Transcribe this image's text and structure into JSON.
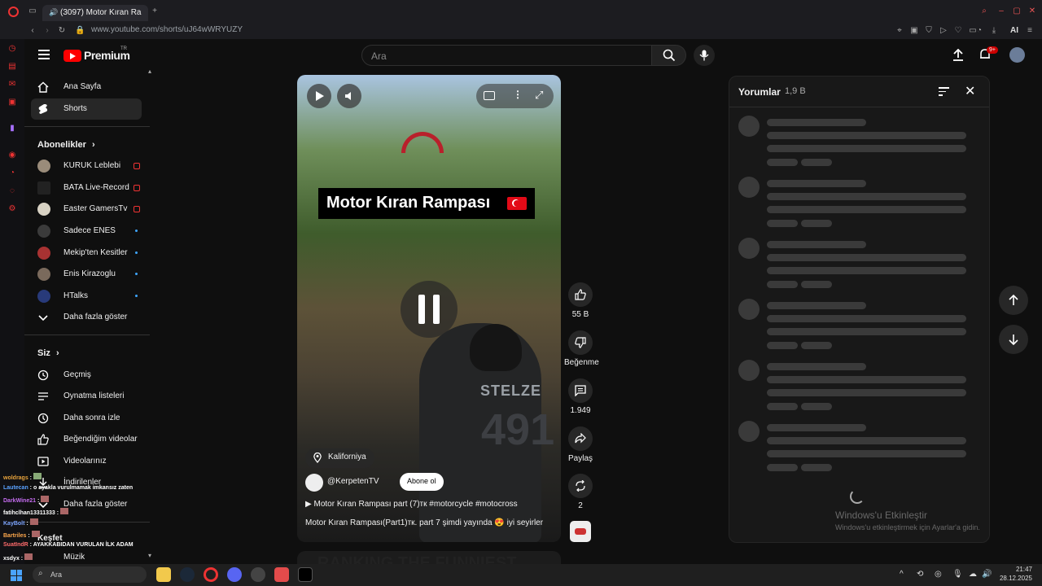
{
  "browser": {
    "tab_title": "(3097) Motor Kıran Ra",
    "url": "www.youtube.com/shorts/uJ64wWRYUZY",
    "ai_label": "AI"
  },
  "header": {
    "logo_text": "Premium",
    "logo_region": "TR",
    "search_placeholder": "Ara",
    "notifications_badge": "9+"
  },
  "guide": {
    "main": [
      {
        "label": "Ana Sayfa",
        "icon": "home-icon"
      },
      {
        "label": "Shorts",
        "icon": "shorts-icon",
        "active": true
      }
    ],
    "subscriptions_title": "Abonelikler",
    "subscriptions": [
      {
        "label": "KURUK Leblebi",
        "status": "live"
      },
      {
        "label": "BATA Live-Record",
        "status": "live"
      },
      {
        "label": "Easter GamersTv",
        "status": "live"
      },
      {
        "label": "Sadece ENES",
        "status": "new"
      },
      {
        "label": "Mekip'ten Kesitler",
        "status": "new"
      },
      {
        "label": "Enis Kirazoglu",
        "status": "new"
      },
      {
        "label": "HTalks",
        "status": "new"
      }
    ],
    "show_more": "Daha fazla göster",
    "you_title": "Siz",
    "you": [
      {
        "label": "Geçmiş",
        "icon": "history-icon"
      },
      {
        "label": "Oynatma listeleri",
        "icon": "playlist-icon"
      },
      {
        "label": "Daha sonra izle",
        "icon": "clock-icon"
      },
      {
        "label": "Beğendiğim videolar",
        "icon": "like-icon"
      },
      {
        "label": "Videolarınız",
        "icon": "video-icon"
      },
      {
        "label": "İndirilenler",
        "icon": "download-icon"
      },
      {
        "label": "Daha fazla göster",
        "icon": "chevron-down-icon"
      }
    ],
    "explore_title": "Keşfet",
    "music_label": "Müzik"
  },
  "video": {
    "title_overlay": "Motor Kıran Rampası",
    "location": "Kaliforniya",
    "channel": "@KerpetenTV",
    "subscribe": "Abone ol",
    "description_1": "Motor Kıran Rampası part (7)тк #motorcycle #motocross",
    "description_2": "Motor Kıran Rampası(Part1)тк.      part 7 şimdi yayında 😍 iyi seyirler",
    "next_title": "RANKING THE FUNNIEST"
  },
  "actions": {
    "likes": "55 B",
    "dislike": "Beğenme",
    "comments": "1.949",
    "share": "Paylaş",
    "remix": "2"
  },
  "comments_panel": {
    "title": "Yorumlar",
    "count": "1,9 B"
  },
  "watermark": {
    "line1": "Windows'u Etkinleştir",
    "line2": "Windows'u etkinleştirmek için Ayarlar'a gidin."
  },
  "chat_overlay": [
    {
      "user": "woldrags",
      "text": "",
      "color": "#e6a23c"
    },
    {
      "user": "Lautecan",
      "text": "o ayakla vurulmamak imkansız zaten",
      "color": "#5aa2ff"
    },
    {
      "user": "DarkWine21",
      "text": "",
      "color": "#c56cf0"
    },
    {
      "user": "fatihclhan13311333",
      "text": "",
      "color": "#ffffff"
    },
    {
      "user": "KayBolt",
      "text": "",
      "color": "#7ea6ff"
    },
    {
      "user": "Bartriles",
      "text": "",
      "color": "#ffa94d"
    },
    {
      "user": "SuatIndR",
      "text": "AYAKKABIDAN VURULAN İLK ADAM",
      "color": "#ff6b6b"
    },
    {
      "user": "xsdyx",
      "text": "",
      "color": "#ffffff"
    }
  ],
  "taskbar": {
    "search": "Ara",
    "time": "21:47",
    "date": "28.12.2025"
  },
  "colors": {
    "youtube_red": "#ff0000",
    "background": "#0f0f0f",
    "panel": "#181818",
    "skeleton": "#3a3a3a"
  }
}
